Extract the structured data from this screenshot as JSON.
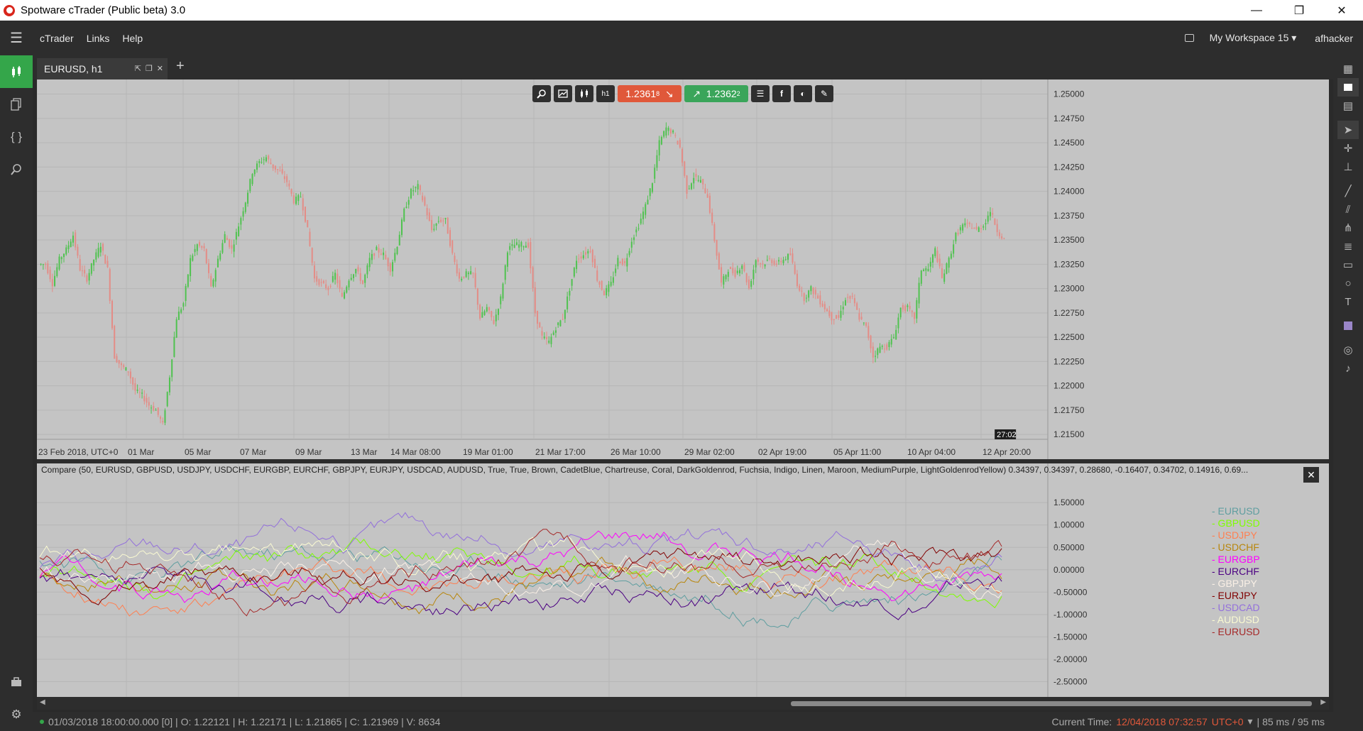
{
  "window": {
    "title": "Spotware cTrader (Public beta) 3.0",
    "min": "—",
    "restore": "❐",
    "close": "✕"
  },
  "menu": {
    "items": [
      "cTrader",
      "Links",
      "Help"
    ],
    "workspace": "My Workspace 15 ▾",
    "user": "afhacker"
  },
  "tab": {
    "label": "EURUSD, h1",
    "add": "+"
  },
  "toolstrip": {
    "sell_price": "1.2361",
    "sell_sup": "8",
    "sell_arrow": "↘",
    "buy_price": "1.2362",
    "buy_sup": "2",
    "buy_arrow": "↗",
    "h_label": "h1"
  },
  "colors": {
    "accent": "#34a64a",
    "sell": "#e0583a",
    "buy": "#3aa55a",
    "chart_bg": "#c4c4c4",
    "bull": "#4fc24f",
    "bear": "#e48c86"
  },
  "indicator": {
    "title": "Compare (50, EURUSD, GBPUSD, USDJPY, USDCHF, EURGBP, EURCHF, GBPJPY, EURJPY, USDCAD, AUDUSD, True, True, Brown, CadetBlue, Chartreuse, Coral, DarkGoldenrod, Fuchsia, Indigo, Linen, Maroon, MediumPurple, LightGoldenrodYellow) 0.34397, 0.34397, 0.28680, -0.16407, 0.34702, 0.14916, 0.69..."
  },
  "chart_data": [
    {
      "type": "line",
      "title": "EURUSD, h1",
      "y_ticks": [
        "1.25000",
        "1.24750",
        "1.24500",
        "1.24250",
        "1.24000",
        "1.23750",
        "1.23500",
        "1.23250",
        "1.23000",
        "1.22750",
        "1.22500",
        "1.22250",
        "1.22000",
        "1.21750",
        "1.21500"
      ],
      "x_ticks": [
        "23 Feb 2018, UTC+0",
        "01 Mar",
        "05 Mar",
        "07 Mar",
        "09 Mar",
        "13 Mar",
        "14 Mar 08:00",
        "19 Mar 01:00",
        "21 Mar 17:00",
        "26 Mar 10:00",
        "29 Mar 02:00",
        "02 Apr 19:00",
        "05 Apr 11:00",
        "10 Apr 04:00",
        "12 Apr 20:00"
      ],
      "ylim": [
        1.2145,
        1.2515
      ],
      "countdown": "27:02",
      "closes": [
        1.2325,
        1.2305,
        1.233,
        1.234,
        1.2355,
        1.232,
        1.231,
        1.233,
        1.2345,
        1.232,
        1.223,
        1.222,
        1.2215,
        1.2195,
        1.219,
        1.218,
        1.2175,
        1.216,
        1.221,
        1.227,
        1.2285,
        1.233,
        1.2345,
        1.234,
        1.23,
        1.233,
        1.2355,
        1.234,
        1.2365,
        1.239,
        1.242,
        1.243,
        1.2435,
        1.2425,
        1.242,
        1.241,
        1.239,
        1.2395,
        1.236,
        1.231,
        1.2305,
        1.23,
        1.2315,
        1.229,
        1.231,
        1.232,
        1.2305,
        1.233,
        1.234,
        1.2335,
        1.232,
        1.2345,
        1.238,
        1.24,
        1.2405,
        1.2385,
        1.236,
        1.237,
        1.237,
        1.2335,
        1.231,
        1.2315,
        1.2315,
        1.227,
        1.228,
        1.2265,
        1.229,
        1.234,
        1.2345,
        1.2345,
        1.2345,
        1.2275,
        1.225,
        1.2245,
        1.226,
        1.227,
        1.23,
        1.233,
        1.2335,
        1.234,
        1.231,
        1.2295,
        1.2305,
        1.233,
        1.2325,
        1.235,
        1.2365,
        1.2385,
        1.241,
        1.245,
        1.2465,
        1.246,
        1.2445,
        1.24,
        1.2415,
        1.241,
        1.2395,
        1.235,
        1.2305,
        1.232,
        1.2315,
        1.2325,
        1.23,
        1.233,
        1.2325,
        1.233,
        1.2325,
        1.233,
        1.2335,
        1.2305,
        1.229,
        1.23,
        1.229,
        1.228,
        1.227,
        1.227,
        1.229,
        1.229,
        1.227,
        1.226,
        1.223,
        1.224,
        1.224,
        1.225,
        1.228,
        1.228,
        1.227,
        1.232,
        1.232,
        1.234,
        1.231,
        1.233,
        1.2355,
        1.2365,
        1.2365,
        1.236,
        1.2365,
        1.238,
        1.236,
        1.235
      ]
    },
    {
      "type": "line",
      "title": "Compare",
      "y_ticks": [
        "1.50000",
        "1.00000",
        "0.50000",
        "0.00000",
        "-0.50000",
        "-1.00000",
        "-1.50000",
        "-2.00000",
        "-2.50000"
      ],
      "ylim": [
        -2.7,
        1.9
      ],
      "series": [
        {
          "name": "- EURUSD",
          "color": "#5f9ea0",
          "seed": 3
        },
        {
          "name": "- GBPUSD",
          "color": "#7fff00",
          "seed": 7
        },
        {
          "name": "- USDJPY",
          "color": "#ff7f50",
          "seed": 11
        },
        {
          "name": "- USDCHF",
          "color": "#b8860b",
          "seed": 13
        },
        {
          "name": "- EURGBP",
          "color": "#ff00ff",
          "seed": 17
        },
        {
          "name": "- EURCHF",
          "color": "#4b0082",
          "seed": 19
        },
        {
          "name": "- GBPJPY",
          "color": "#faf0e6",
          "seed": 23
        },
        {
          "name": "- EURJPY",
          "color": "#800000",
          "seed": 29
        },
        {
          "name": "- USDCAD",
          "color": "#9370db",
          "seed": 31
        },
        {
          "name": "- AUDUSD",
          "color": "#fafad2",
          "seed": 37
        },
        {
          "name": "- EURUSD",
          "color": "#a52a2a",
          "seed": 41
        }
      ]
    }
  ],
  "status": {
    "bar_info": "01/03/2018 18:00:00.000 [0] | O: 1.22121 | H: 1.22171 | L: 1.21865 | C: 1.21969 | V: 8634",
    "current_time_label": "Current Time:",
    "current_time": "12/04/2018 07:32:57",
    "tz": "UTC+0",
    "tz_arrow": "▾",
    "latency": "| 85 ms / 95 ms"
  }
}
